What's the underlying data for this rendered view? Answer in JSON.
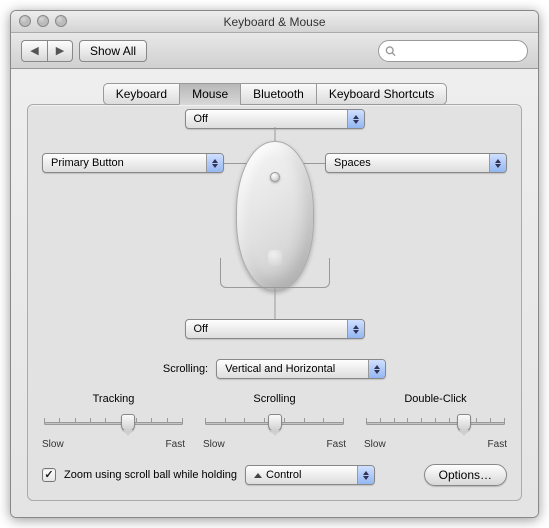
{
  "window": {
    "title": "Keyboard & Mouse"
  },
  "toolbar": {
    "back_label": "◀",
    "fwd_label": "▶",
    "showall_label": "Show All",
    "search_placeholder": ""
  },
  "tabs": [
    {
      "label": "Keyboard"
    },
    {
      "label": "Mouse"
    },
    {
      "label": "Bluetooth"
    },
    {
      "label": "Keyboard Shortcuts"
    }
  ],
  "active_tab_index": 1,
  "mouse": {
    "top_button": "Off",
    "left_button": "Primary Button",
    "right_button": "Spaces",
    "side_button": "Off"
  },
  "scrolling": {
    "label": "Scrolling:",
    "value": "Vertical and Horizontal"
  },
  "sliders": {
    "tracking": {
      "label": "Tracking",
      "minlabel": "Slow",
      "maxlabel": "Fast",
      "value_pct": 60,
      "ticks": 10
    },
    "scrolling": {
      "label": "Scrolling",
      "minlabel": "Slow",
      "maxlabel": "Fast",
      "value_pct": 50,
      "ticks": 8
    },
    "doubleclick": {
      "label": "Double-Click",
      "minlabel": "Slow",
      "maxlabel": "Fast",
      "value_pct": 70,
      "ticks": 11
    }
  },
  "zoom": {
    "checked": true,
    "label": "Zoom using scroll ball while holding",
    "modkey_symbol": "^",
    "modkey_name": "Control",
    "options_label": "Options…"
  }
}
